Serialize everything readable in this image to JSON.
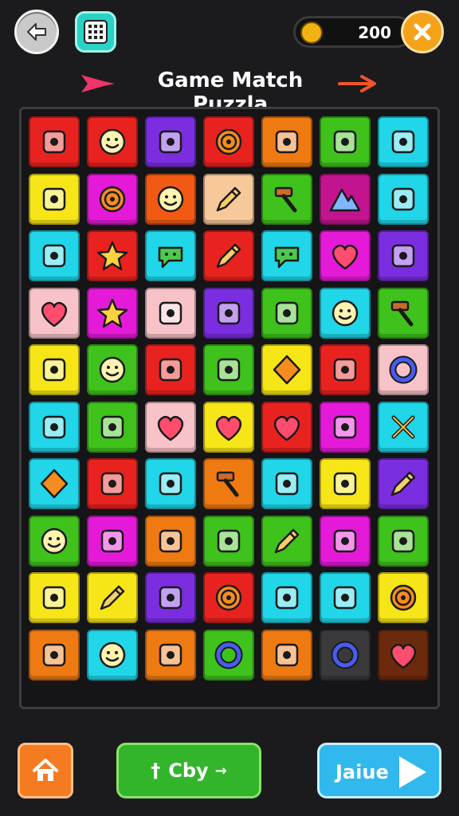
{
  "header": {
    "title": "Game Match Puzzla",
    "score": "200",
    "back_icon": "back-arrow-icon",
    "grid_icon": "grid-calendar-icon",
    "coin_icon": "coin-icon",
    "close_icon": "close-icon"
  },
  "board": {
    "rows": [
      [
        {
          "color": "#e8231f",
          "icon": "cat-face-icon"
        },
        {
          "color": "#e8231f",
          "icon": "smiley-icon"
        },
        {
          "color": "#7b2de0",
          "icon": "cassette-icon"
        },
        {
          "color": "#e8231f",
          "icon": "sun-icon"
        },
        {
          "color": "#f07a12",
          "icon": "popsicle-icon"
        },
        {
          "color": "#3fc21c",
          "icon": "eraser-icon"
        },
        {
          "color": "#20d6e8",
          "icon": "cactus-icon"
        }
      ],
      [
        {
          "color": "#f7e617",
          "icon": "bus-icon"
        },
        {
          "color": "#e51ad8",
          "icon": "spiral-icon"
        },
        {
          "color": "#f25a14",
          "icon": "face-icon"
        },
        {
          "color": "#f7c89a",
          "icon": "pen-icon"
        },
        {
          "color": "#3fc21c",
          "icon": "hammer-icon"
        },
        {
          "color": "#c2148e",
          "icon": "mountain-icon"
        },
        {
          "color": "#20d6e8",
          "icon": "tv-icon"
        }
      ],
      [
        {
          "color": "#20d6e8",
          "icon": "number-box-icon"
        },
        {
          "color": "#e8231f",
          "icon": "splat-icon"
        },
        {
          "color": "#20d6e8",
          "icon": "cloud-icon"
        },
        {
          "color": "#e8231f",
          "icon": "feather-icon"
        },
        {
          "color": "#20d6e8",
          "icon": "speech-bubble-icon"
        },
        {
          "color": "#e51ad8",
          "icon": "heart-icon"
        },
        {
          "color": "#7b2de0",
          "icon": "calendar-icon"
        }
      ],
      [
        {
          "color": "#f7c3c8",
          "icon": "heart-icon"
        },
        {
          "color": "#e51ad8",
          "icon": "star-icon"
        },
        {
          "color": "#f7c3c8",
          "icon": "box-icon"
        },
        {
          "color": "#7b2de0",
          "icon": "book-icon"
        },
        {
          "color": "#3fc21c",
          "icon": "fish-icon"
        },
        {
          "color": "#20d6e8",
          "icon": "sheep-icon"
        },
        {
          "color": "#3fc21c",
          "icon": "palette-icon"
        }
      ],
      [
        {
          "color": "#f7e617",
          "icon": "watermelon-icon"
        },
        {
          "color": "#3fc21c",
          "icon": "face-icon"
        },
        {
          "color": "#e8231f",
          "icon": "picture-icon"
        },
        {
          "color": "#3fc21c",
          "icon": "dice-icon"
        },
        {
          "color": "#f7e617",
          "icon": "diamond-icon"
        },
        {
          "color": "#e8231f",
          "icon": "camera-icon"
        },
        {
          "color": "#f7c3c8",
          "icon": "ring-icon"
        }
      ],
      [
        {
          "color": "#20d6e8",
          "icon": "blob-icon"
        },
        {
          "color": "#3fc21c",
          "icon": "bird-icon"
        },
        {
          "color": "#f7c3c8",
          "icon": "heart-face-icon"
        },
        {
          "color": "#f7e617",
          "icon": "heart-icon"
        },
        {
          "color": "#e8231f",
          "icon": "heart-icon"
        },
        {
          "color": "#e51ad8",
          "icon": "splash-icon"
        },
        {
          "color": "#20d6e8",
          "icon": "cross-icon"
        }
      ],
      [
        {
          "color": "#20d6e8",
          "icon": "kite-icon"
        },
        {
          "color": "#e8231f",
          "icon": "chick-icon"
        },
        {
          "color": "#20d6e8",
          "icon": "bird-icon"
        },
        {
          "color": "#f07a12",
          "icon": "paddle-icon"
        },
        {
          "color": "#20d6e8",
          "icon": "robot-icon"
        },
        {
          "color": "#f7e617",
          "icon": "burger-icon"
        },
        {
          "color": "#7b2de0",
          "icon": "leaf-icon"
        }
      ],
      [
        {
          "color": "#3fc21c",
          "icon": "face-icon"
        },
        {
          "color": "#e51ad8",
          "icon": "webcam-icon"
        },
        {
          "color": "#f07a12",
          "icon": "envelope-icon"
        },
        {
          "color": "#3fc21c",
          "icon": "pineapple-icon"
        },
        {
          "color": "#3fc21c",
          "icon": "marker-icon"
        },
        {
          "color": "#e51ad8",
          "icon": "phone-icon"
        },
        {
          "color": "#3fc21c",
          "icon": "frame-icon"
        }
      ],
      [
        {
          "color": "#f7e617",
          "icon": "tablet-icon"
        },
        {
          "color": "#f7e617",
          "icon": "leaf-icon"
        },
        {
          "color": "#7b2de0",
          "icon": "card-icon"
        },
        {
          "color": "#e8231f",
          "icon": "flower-icon"
        },
        {
          "color": "#20d6e8",
          "icon": "bottle-icon"
        },
        {
          "color": "#20d6e8",
          "icon": "carrot-icon"
        },
        {
          "color": "#f7e617",
          "icon": "spiral-icon"
        }
      ],
      [
        {
          "color": "#f07a12",
          "icon": "picture-icon"
        },
        {
          "color": "#20d6e8",
          "icon": "droplet-face-icon"
        },
        {
          "color": "#f07a12",
          "icon": "eraser-icon"
        },
        {
          "color": "#3fc21c",
          "icon": "search-ring-icon"
        },
        {
          "color": "#f07a12",
          "icon": "tag-icon"
        },
        {
          "color": "#3a3a3c",
          "icon": "ring-icon"
        },
        {
          "color": "#6b2a0e",
          "icon": "heart-icon"
        }
      ]
    ]
  },
  "footer": {
    "home_icon": "home-icon",
    "center_label": "Cby",
    "center_prefix": "†",
    "center_suffix": "→",
    "next_label": "Jaiue",
    "next_icon": "play-icon"
  }
}
